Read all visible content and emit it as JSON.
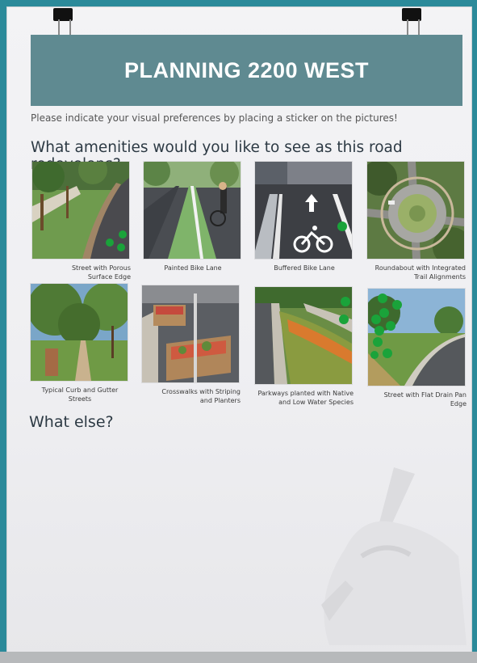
{
  "poster": {
    "title": "PLANNING 2200 WEST",
    "intro": "Please indicate your visual preferences by placing a sticker on the pictures!",
    "question": "What amenities would you like to see as this road redevelops?",
    "what_else": "What else?"
  },
  "photos": [
    {
      "caption_line1": "Street with Porous",
      "caption_line2": "Surface Edge",
      "stickers": 3
    },
    {
      "caption_line1": "Painted Bike Lane",
      "caption_line2": "",
      "stickers": 0
    },
    {
      "caption_line1": "Buffered Bike Lane",
      "caption_line2": "",
      "stickers": 1
    },
    {
      "caption_line1": "Roundabout with Integrated",
      "caption_line2": "Trail Alignments",
      "stickers": 0
    },
    {
      "caption_line1": "Typical Curb and Gutter Streets",
      "caption_line2": "",
      "stickers": 0
    },
    {
      "caption_line1": "Crosswalks with Striping",
      "caption_line2": "and Planters",
      "stickers": 0
    },
    {
      "caption_line1": "Parkways planted with Native",
      "caption_line2": "and Low Water Species",
      "stickers": 2
    },
    {
      "caption_line1": "Street with Flat Drain Pan Edge",
      "caption_line2": "",
      "stickers": 9
    }
  ],
  "colors": {
    "banner": "#5f8a91",
    "sticker": "#1aa33a",
    "border": "#2b8a9a"
  }
}
